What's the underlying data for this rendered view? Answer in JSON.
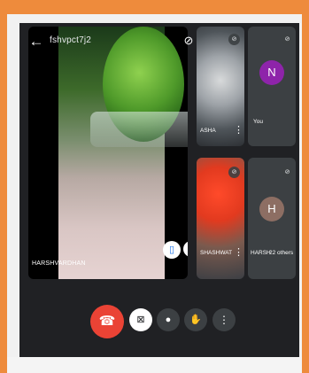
{
  "header": {
    "back_icon": "arrow-left-icon",
    "meeting_code": "fshvpct7j2",
    "top_icons": [
      "mute-icon",
      "switch-camera-icon",
      "bluetooth-icon"
    ]
  },
  "tiles": {
    "main": {
      "name": "HARSHVARDHAN",
      "buttons": [
        "pin-icon",
        "fullscreen-icon"
      ]
    },
    "tile_a": {
      "name": "ASHA"
    },
    "tile_b": {
      "name": "SHASHWAT"
    },
    "you": {
      "avatar_letter": "N",
      "avatar_color": "#8e24aa",
      "label": "You"
    },
    "others": {
      "avatar_letter": "H",
      "avatar_color": "#8d6e63",
      "name": "HARSH",
      "label": "22 others"
    }
  },
  "controls": [
    "end-call-icon",
    "camera-off-icon",
    "mic-icon",
    "raise-hand-icon",
    "more-vert-icon"
  ],
  "colors": {
    "accent_red": "#ea4335",
    "background": "#202124",
    "border_orange": "#ee8b3c"
  }
}
